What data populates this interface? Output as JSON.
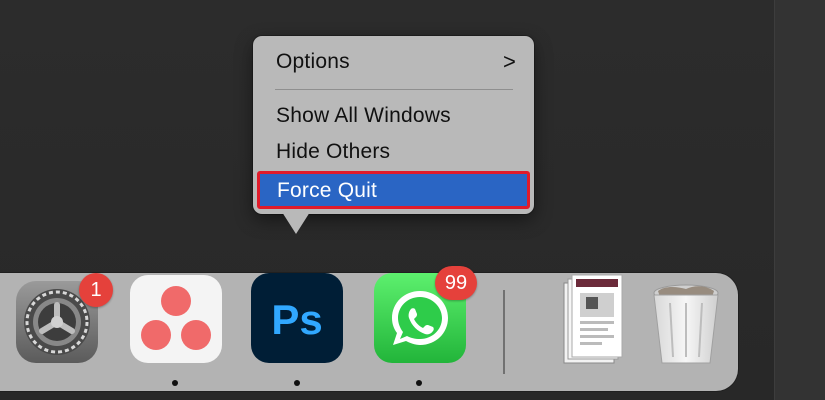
{
  "menu": {
    "items": [
      {
        "label": "Options",
        "has_submenu": true,
        "chevron": ">"
      },
      {
        "label": "Show All Windows"
      },
      {
        "label": "Hide Others"
      },
      {
        "label": "Force Quit",
        "highlighted": true
      }
    ]
  },
  "dock": {
    "apps": [
      {
        "name": "settings-icon",
        "badge": "1",
        "running": false
      },
      {
        "name": "asana-icon",
        "running": true
      },
      {
        "name": "photoshop-icon",
        "text": "Ps",
        "running": true
      },
      {
        "name": "whatsapp-icon",
        "badge": "99",
        "running": true
      },
      {
        "name": "document-stack-icon",
        "running": false
      },
      {
        "name": "trash-icon",
        "running": false
      }
    ]
  },
  "colors": {
    "highlight": "#2a65c4",
    "highlight_border": "#e01b2a",
    "badge": "#e5413b",
    "whatsapp_green": "#2ecc4a",
    "photoshop_blue": "#31a8ff",
    "photoshop_bg": "#001e36",
    "asana_pink": "#f06a6a"
  }
}
